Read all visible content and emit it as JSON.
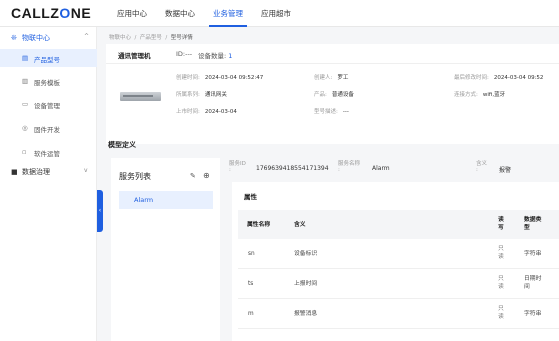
{
  "app": {
    "logo_pre": "CALLZ",
    "logo_o": "O",
    "logo_post": "NE"
  },
  "nav": {
    "items": [
      "应用中心",
      "数据中心",
      "业务管理",
      "应用超市"
    ],
    "active": "业务管理"
  },
  "sidebar": {
    "group1": {
      "icon": "❊",
      "label": "物联中心",
      "chevron": "^"
    },
    "items": [
      {
        "icon": "▤",
        "label": "产品型号"
      },
      {
        "icon": "▥",
        "label": "服务模板"
      },
      {
        "icon": "▭",
        "label": "设备管理"
      },
      {
        "icon": "◎",
        "label": "固件开发"
      },
      {
        "icon": "▫",
        "label": "软件运管"
      }
    ],
    "group2": {
      "icon": "■",
      "label": "数据治理",
      "chevron": "v"
    },
    "collapse_icon": "‹"
  },
  "breadcrumb": {
    "items": [
      "物联中心",
      "产品型号",
      "型号详情"
    ],
    "sep": "/"
  },
  "product": {
    "name": "通讯管理机",
    "id_text": "ID:---",
    "count_label": "设备数量:",
    "count_value": "1",
    "fields": {
      "created_time": {
        "k": "创建时间:",
        "v": "2024-03-04 09:52:47"
      },
      "creator": {
        "k": "创建人:",
        "v": "罗工"
      },
      "last_modified": {
        "k": "最后修改时间:",
        "v": "2024-03-04 09:52"
      },
      "category": {
        "k": "所属系列:",
        "v": "通讯网关"
      },
      "product": {
        "k": "产品:",
        "v": "普通设备"
      },
      "connect": {
        "k": "连接方式:",
        "v": "wifi,蓝牙"
      },
      "launch_time": {
        "k": "上市时间:",
        "v": "2024-03-04"
      },
      "model_desc": {
        "k": "型号描述:",
        "v": "---"
      }
    }
  },
  "model_def": {
    "title": "模型定义"
  },
  "service_list": {
    "title": "服务列表",
    "edit_icon": "✎",
    "add_icon": "⊕",
    "items": [
      "Alarm"
    ]
  },
  "service_meta": {
    "id_key": "服务ID",
    "id_colon": ":",
    "id_value": "1769639418554171394",
    "name_key": "服务名称",
    "name_colon": ":",
    "name_value": "Alarm",
    "meaning_key": "含义",
    "meaning_colon": ":",
    "meaning_value": "报警"
  },
  "attributes": {
    "title": "属性",
    "headers": {
      "name": "属性名称",
      "meaning": "含义",
      "rw_1": "读",
      "rw_2": "写",
      "dtype_1": "数据类",
      "dtype_2": "型"
    },
    "rows": [
      {
        "name": "sn",
        "meaning": "设备标识",
        "rw_1": "只",
        "rw_2": "读",
        "dtype_1": "字符串",
        "dtype_2": ""
      },
      {
        "name": "ts",
        "meaning": "上报时间",
        "rw_1": "只",
        "rw_2": "读",
        "dtype_1": "日期时",
        "dtype_2": "间"
      },
      {
        "name": "m",
        "meaning": "报警消息",
        "rw_1": "只",
        "rw_2": "读",
        "dtype_1": "字符串",
        "dtype_2": ""
      }
    ]
  },
  "colors": {
    "accent": "#1f5fe0",
    "active_bg": "#e8f0fe",
    "page_bg": "#f5f6f8"
  }
}
